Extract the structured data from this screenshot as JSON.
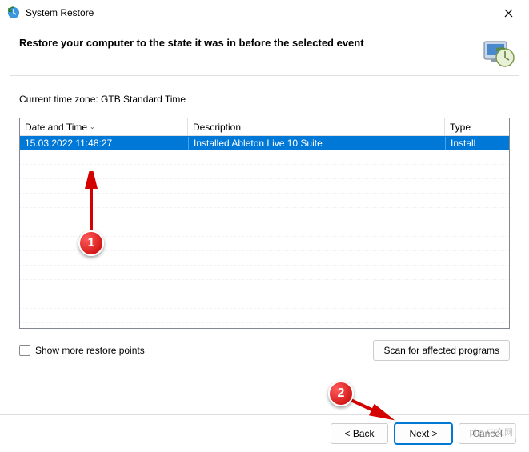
{
  "window": {
    "title": "System Restore"
  },
  "header": {
    "title": "Restore your computer to the state it was in before the selected event"
  },
  "timezone": {
    "label": "Current time zone: GTB Standard Time"
  },
  "table": {
    "columns": {
      "date": "Date and Time",
      "desc": "Description",
      "type": "Type"
    },
    "rows": [
      {
        "date": "15.03.2022 11:48:27",
        "desc": "Installed Ableton Live 10 Suite",
        "type": "Install"
      }
    ]
  },
  "checkbox": {
    "label": "Show more restore points"
  },
  "buttons": {
    "scan": "Scan for affected programs",
    "back": "< Back",
    "next": "Next >",
    "cancel": "Cancel"
  },
  "annotations": {
    "badge1": "1",
    "badge2": "2"
  },
  "watermark": "php 中文网"
}
